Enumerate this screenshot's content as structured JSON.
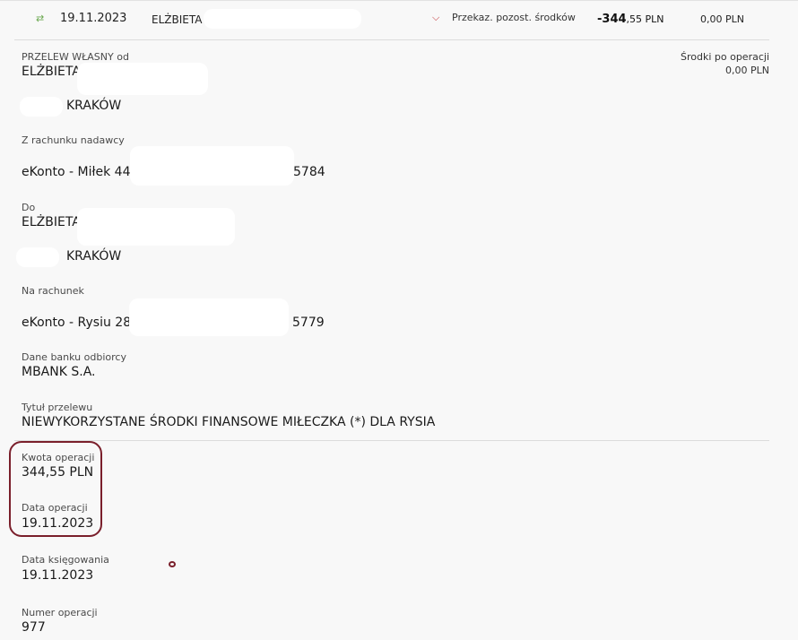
{
  "transaction_row": {
    "date": "19.11.2023",
    "recipient_name": "ELŻBIETA",
    "type": "Przekaz. pozost. środków",
    "amount_int": "-344",
    "amount_dec": ",55 PLN",
    "balance": "0,00 PLN"
  },
  "details": {
    "transfer_type_label": "PRZELEW WŁASNY od",
    "sender_name": "ELŻBIETA",
    "sender_city": "KRAKÓW",
    "balance_after_label": "Środki po operacji",
    "balance_after_value": "0,00 PLN",
    "from_account_label": "Z rachunku nadawcy",
    "from_account_name": "eKonto - Miłek 44",
    "from_account_suffix": "5784",
    "to_label": "Do",
    "to_name": "ELŻBIETA",
    "to_city": "KRAKÓW",
    "to_account_label": "Na rachunek",
    "to_account_name": "eKonto - Rysiu 28",
    "to_account_suffix": "5779",
    "bank_label": "Dane banku odbiorcy",
    "bank_value": "MBANK S.A.",
    "title_label": "Tytuł przelewu",
    "title_value": "NIEWYKORZYSTANE ŚRODKI FINANSOWE MIŁECZKA (*) DLA RYSIA",
    "amount_label": "Kwota operacji",
    "amount_value": "344,55 PLN",
    "op_date_label": "Data operacji",
    "op_date_value": "19.11.2023",
    "booking_date_label": "Data księgowania",
    "booking_date_value": "19.11.2023",
    "op_number_label": "Numer operacji",
    "op_number_value": "977"
  },
  "icons": {
    "transfer": "transfer-arrows-icon",
    "expand": "chevron-down-icon"
  },
  "colors": {
    "background": "#f8f8f8",
    "accent_red": "#c0282d",
    "highlight": "#7a1f2b",
    "arrow_green": "#6aa84f"
  }
}
